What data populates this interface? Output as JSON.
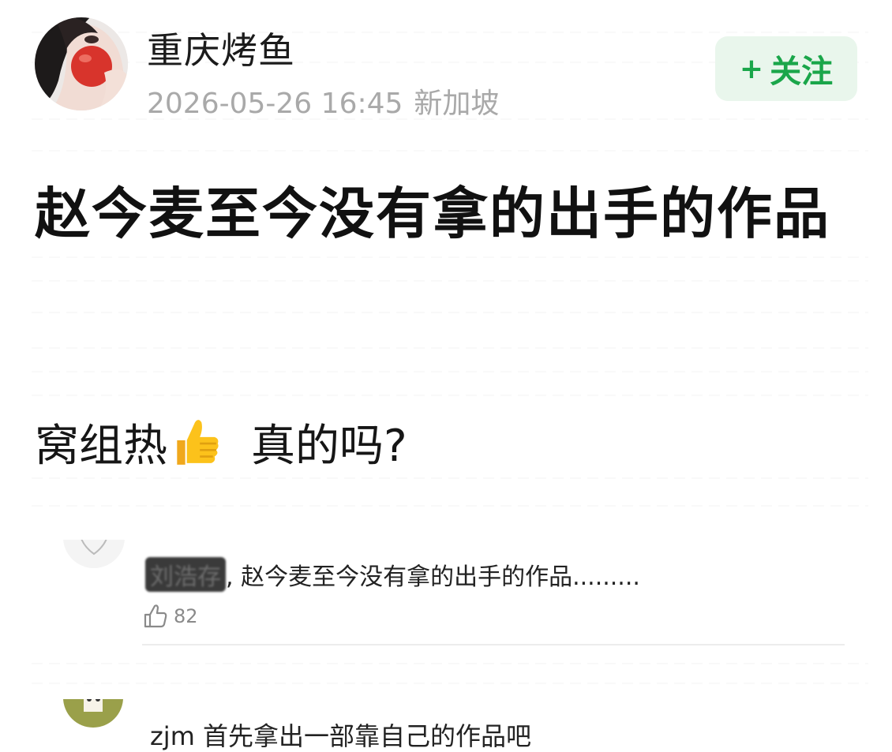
{
  "post": {
    "author": "重庆烤鱼",
    "datetime": "2026-05-26 16:45",
    "location": "新加坡",
    "follow_plus": "+",
    "follow_label": "关注",
    "title": "赵今麦至今没有拿的出手的作品",
    "body_before_emoji": "窝组热",
    "emoji_icon": "thumbs-up-icon",
    "body_after_emoji": "真的吗?"
  },
  "comments": [
    {
      "name": "刘浩存",
      "separator": ",",
      "text": "赵今麦至今没有拿的出手的作品.........",
      "likes": "82"
    },
    {
      "name": "zjm",
      "text": "首先拿出一部靠自己的作品吧"
    }
  ],
  "colors": {
    "follow_green": "#1aa64a",
    "follow_bg": "#e9f6ec",
    "meta_gray": "#a9a9a9"
  }
}
